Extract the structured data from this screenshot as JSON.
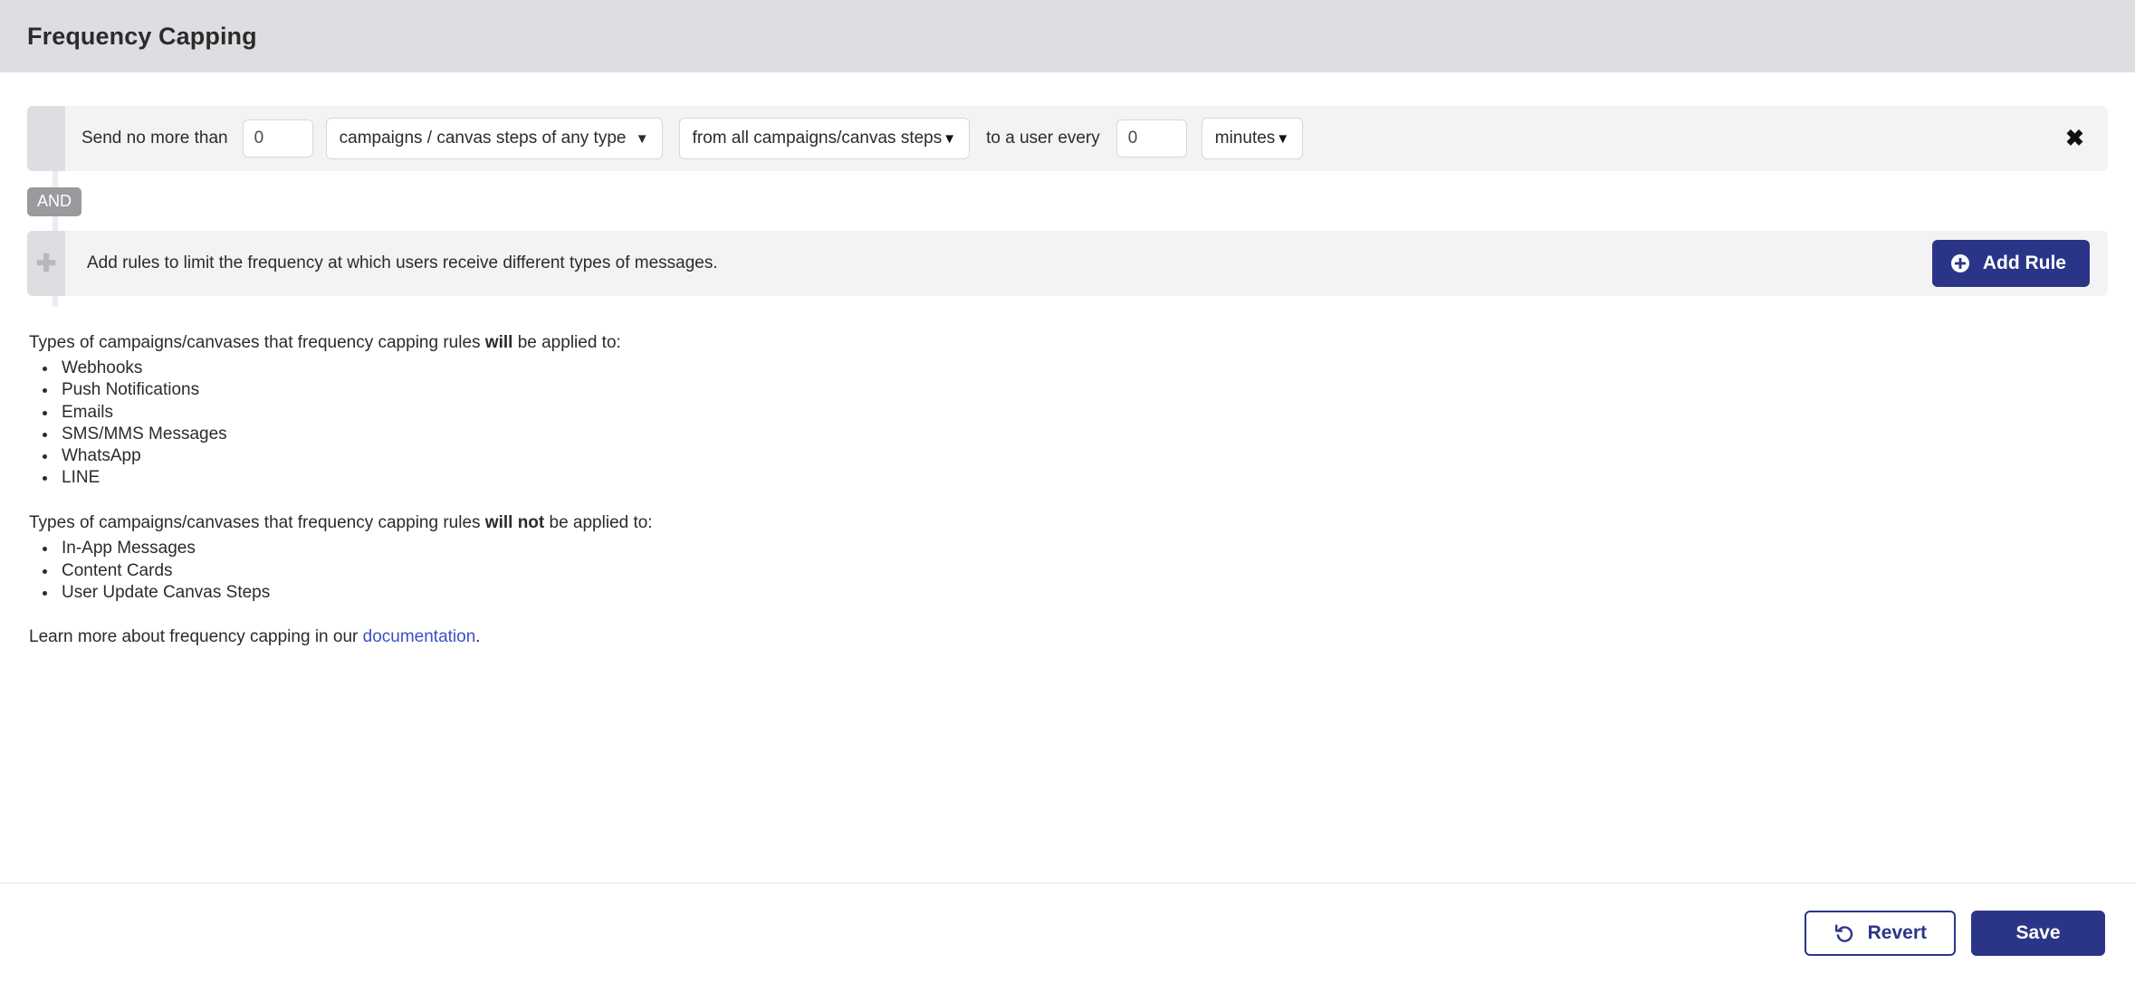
{
  "header": {
    "title": "Frequency Capping"
  },
  "rule": {
    "prefix_label": "Send no more than",
    "count_value": "0",
    "count_placeholder": "0",
    "message_type_select": "campaigns / canvas steps of any type",
    "scope_select": "from all campaigns/canvas steps",
    "middle_label": "to a user every",
    "interval_value": "0",
    "interval_placeholder": "0",
    "unit_select": "minutes",
    "remove_icon": "✖",
    "caret_icon": "▼",
    "and_badge": "AND"
  },
  "add_rule_row": {
    "plus_handle_icon": "✚",
    "description": "Add rules to limit the frequency at which users receive different types of messages.",
    "button_label": "Add Rule"
  },
  "info": {
    "applied_intro_prefix": "Types of campaigns/canvases that frequency capping rules ",
    "applied_intro_strong": "will",
    "applied_intro_suffix": " be applied to:",
    "applied_items": [
      "Webhooks",
      "Push Notifications",
      "Emails",
      "SMS/MMS Messages",
      "WhatsApp",
      "LINE"
    ],
    "not_applied_intro_prefix": "Types of campaigns/canvases that frequency capping rules ",
    "not_applied_intro_strong": "will not",
    "not_applied_intro_suffix": " be applied to:",
    "not_applied_items": [
      "In-App Messages",
      "Content Cards",
      "User Update Canvas Steps"
    ],
    "learn_more_prefix": "Learn more about frequency capping in our ",
    "learn_more_link": "documentation",
    "learn_more_suffix": "."
  },
  "footer": {
    "revert_label": "Revert",
    "save_label": "Save"
  },
  "colors": {
    "brand_blue": "#2b3588",
    "link_blue": "#3b4fc8",
    "header_band": "#dedee2",
    "row_bg": "#f3f3f5",
    "handle_gray": "#dedee2",
    "and_badge_gray": "#9a9a9e"
  }
}
